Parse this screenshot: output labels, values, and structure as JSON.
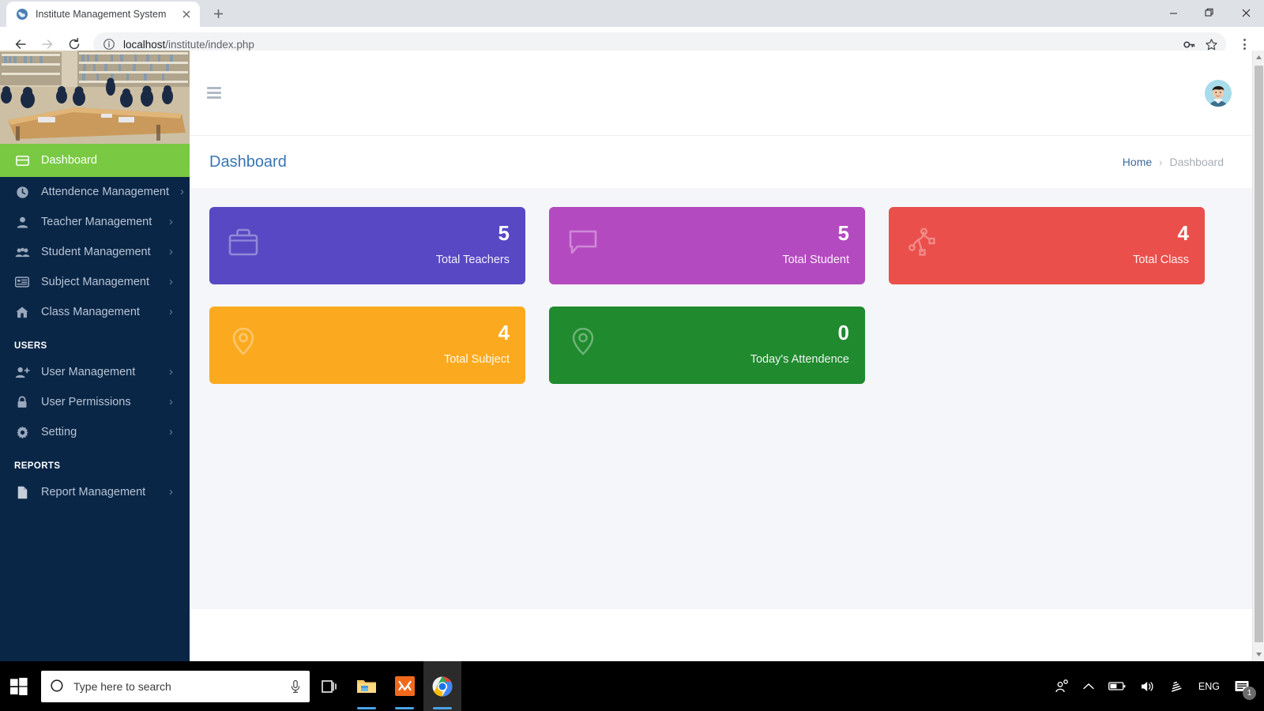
{
  "browser": {
    "tab": {
      "title": "Institute Management System",
      "favicon": "globe-icon",
      "close": "×"
    },
    "new_tab_label": "+",
    "window_controls": {
      "minimize": "−",
      "restore": "❐",
      "close": "✕"
    },
    "nav": {
      "back": "←",
      "forward": "→",
      "reload": "⟳"
    },
    "omnibox": {
      "info_icon": "info-circle-icon",
      "url_host": "localhost",
      "url_path": "/institute/index.php",
      "key_icon": "key-icon",
      "star_icon": "star-icon"
    },
    "menu_icon": "three-dot-menu-icon"
  },
  "sidebar": {
    "banner_alt": "library-photo",
    "items": [
      {
        "label": "Dashboard",
        "icon": "dashboard-icon",
        "active": true,
        "arrow": false
      },
      {
        "label": "Attendence Management",
        "icon": "clock-icon",
        "active": false,
        "arrow": true
      },
      {
        "label": "Teacher Management",
        "icon": "user-icon",
        "active": false,
        "arrow": true
      },
      {
        "label": "Student Management",
        "icon": "users-icon",
        "active": false,
        "arrow": true
      },
      {
        "label": "Subject Management",
        "icon": "list-icon",
        "active": false,
        "arrow": true
      },
      {
        "label": "Class Management",
        "icon": "home-icon",
        "active": false,
        "arrow": true
      }
    ],
    "section_users": "USERS",
    "user_items": [
      {
        "label": "User Management",
        "icon": "user-plus-icon",
        "active": false,
        "arrow": true
      },
      {
        "label": "User Permissions",
        "icon": "lock-icon",
        "active": false,
        "arrow": true
      },
      {
        "label": "Setting",
        "icon": "gear-icon",
        "active": false,
        "arrow": true
      }
    ],
    "section_reports": "REPORTS",
    "report_items": [
      {
        "label": "Report Management",
        "icon": "file-icon",
        "active": false,
        "arrow": true
      }
    ],
    "arrow_glyph": "›",
    "bg_color": "#0a2647",
    "active_color": "#7ac943"
  },
  "topbar": {
    "hamburger_icon": "hamburger-menu-icon",
    "avatar_icon": "user-avatar"
  },
  "content_header": {
    "title": "Dashboard",
    "breadcrumb": {
      "home": "Home",
      "separator": "›",
      "current": "Dashboard"
    }
  },
  "cards": [
    {
      "value": "5",
      "label": "Total Teachers",
      "color": "#5848c4",
      "icon": "briefcase-icon"
    },
    {
      "value": "5",
      "label": "Total Student",
      "color": "#b44ac0",
      "icon": "chat-bubble-icon"
    },
    {
      "value": "4",
      "label": "Total Class",
      "color": "#ea4f4b",
      "icon": "share-nodes-icon"
    },
    {
      "value": "4",
      "label": "Total Subject",
      "color": "#fbaa20",
      "icon": "map-pin-icon"
    },
    {
      "value": "0",
      "label": "Today's Attendence",
      "color": "#1f8a2e",
      "icon": "map-pin-icon"
    }
  ],
  "scrollbar": {
    "up": "▲",
    "down": "▼"
  },
  "taskbar": {
    "start_icon": "windows-start-icon",
    "search": {
      "placeholder": "Type here to search",
      "search_icon": "search-circle-icon",
      "mic_icon": "microphone-icon"
    },
    "task_view_icon": "task-view-icon",
    "apps": [
      {
        "name": "file-explorer-icon",
        "running": true
      },
      {
        "name": "xampp-icon",
        "running": true
      },
      {
        "name": "chrome-icon",
        "running": true,
        "active": true
      }
    ],
    "tray": {
      "people_icon": "people-share-icon",
      "chevron_icon": "chevron-up-icon",
      "battery_icon": "battery-icon",
      "volume_icon": "volume-icon",
      "wifi_icon": "wifi-icon",
      "language": "ENG",
      "notification_icon": "notification-icon",
      "notification_count": "1"
    }
  }
}
